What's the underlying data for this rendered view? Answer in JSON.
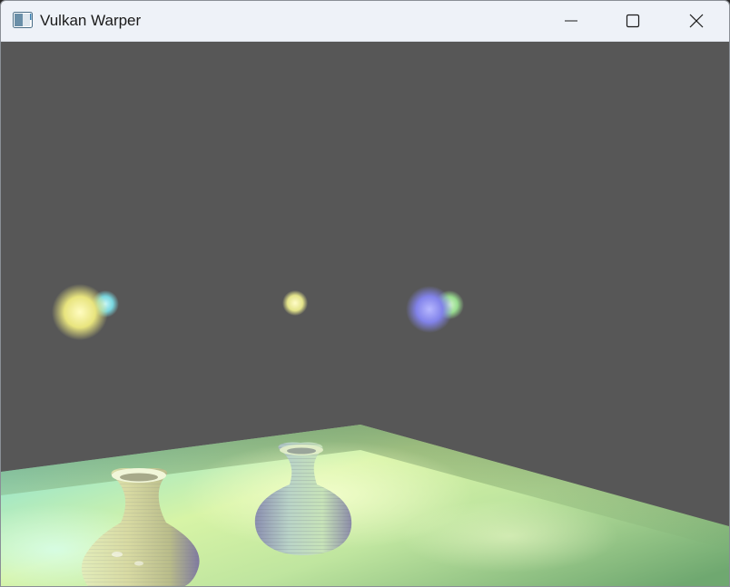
{
  "window": {
    "title": "Vulkan Warper",
    "icon": "app-window-icon",
    "controls": [
      "minimize-icon",
      "maximize-icon",
      "close-icon"
    ]
  },
  "viewport": {
    "background_color": "#575757",
    "scene": {
      "floor_color": "#a8e3a0",
      "lights": [
        {
          "name": "yellow-light-sphere",
          "color": "#f4f08a"
        },
        {
          "name": "cyan-light-sphere",
          "color": "#8ee6ee"
        },
        {
          "name": "small-yellow-light-sphere",
          "color": "#eef094"
        },
        {
          "name": "blue-light-sphere",
          "color": "#8f90f5"
        },
        {
          "name": "green-light-sphere",
          "color": "#a6e8a0"
        }
      ],
      "objects": [
        "front-vase",
        "back-vase"
      ]
    }
  }
}
